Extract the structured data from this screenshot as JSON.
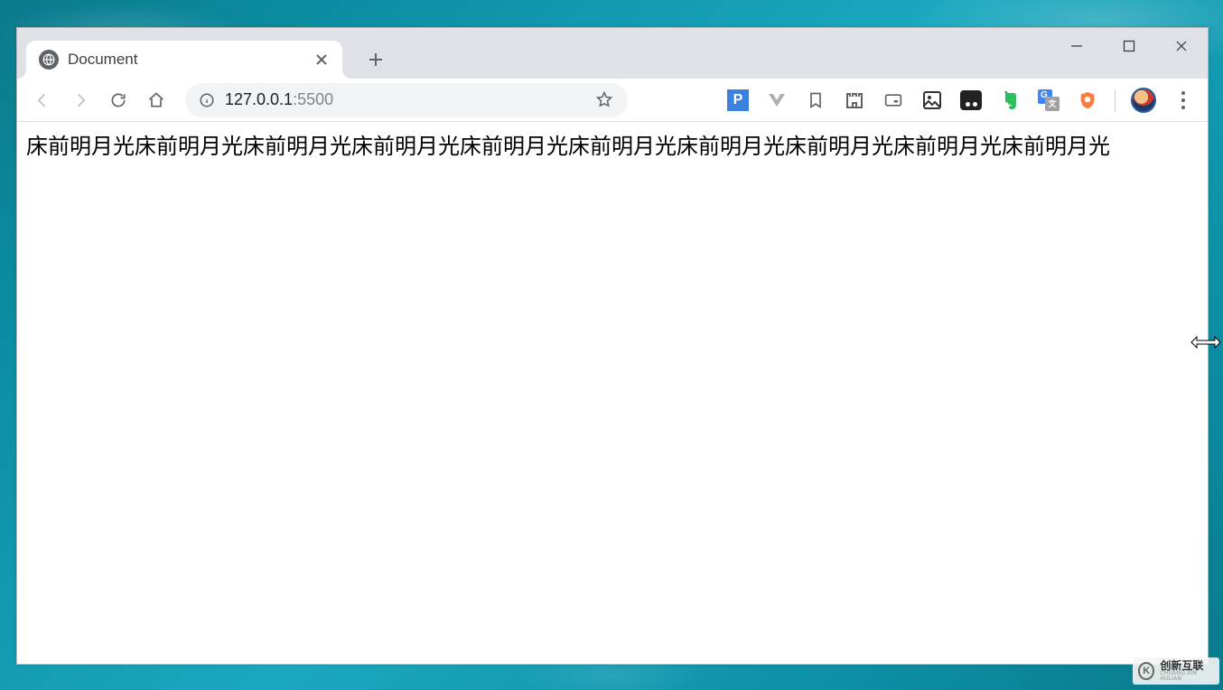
{
  "tab": {
    "title": "Document"
  },
  "address": {
    "host": "127.0.0.1",
    "port": ":5500"
  },
  "page": {
    "text": "床前明月光床前明月光床前明月光床前明月光床前明月光床前明月光床前明月光床前明月光床前明月光床前明月光"
  },
  "watermark": {
    "logo_letter": "K",
    "main": "创新互联",
    "sub": "CHUANG XIN HULIAN"
  },
  "extensions": {
    "items": [
      {
        "name": "p-ext-icon",
        "bg": "#3b82e0",
        "fg": "#fff",
        "letter": "P",
        "shape": "square"
      },
      {
        "name": "v-ext-icon",
        "bg": "transparent",
        "fg": "#9e9e9e",
        "letter": "V",
        "shape": "vchev"
      },
      {
        "name": "bookmark-ext-icon",
        "bg": "transparent",
        "fg": "#5f6368",
        "shape": "bookmark"
      },
      {
        "name": "castle-ext-icon",
        "bg": "transparent",
        "fg": "#5f6368",
        "shape": "castle"
      },
      {
        "name": "video-ext-icon",
        "bg": "transparent",
        "fg": "#5f6368",
        "shape": "video"
      },
      {
        "name": "image-ext-icon",
        "bg": "transparent",
        "fg": "#333",
        "shape": "image"
      },
      {
        "name": "dots-ext-icon",
        "bg": "#222",
        "fg": "#fff",
        "shape": "dots"
      },
      {
        "name": "evernote-ext-icon",
        "bg": "transparent",
        "fg": "#2dbe60",
        "shape": "elephant"
      },
      {
        "name": "translate-ext-icon",
        "bg": "#4285f4",
        "fg": "#fff",
        "shape": "translate"
      },
      {
        "name": "shield-ext-icon",
        "bg": "#ff7a3d",
        "fg": "#fff",
        "shape": "shield"
      }
    ]
  }
}
